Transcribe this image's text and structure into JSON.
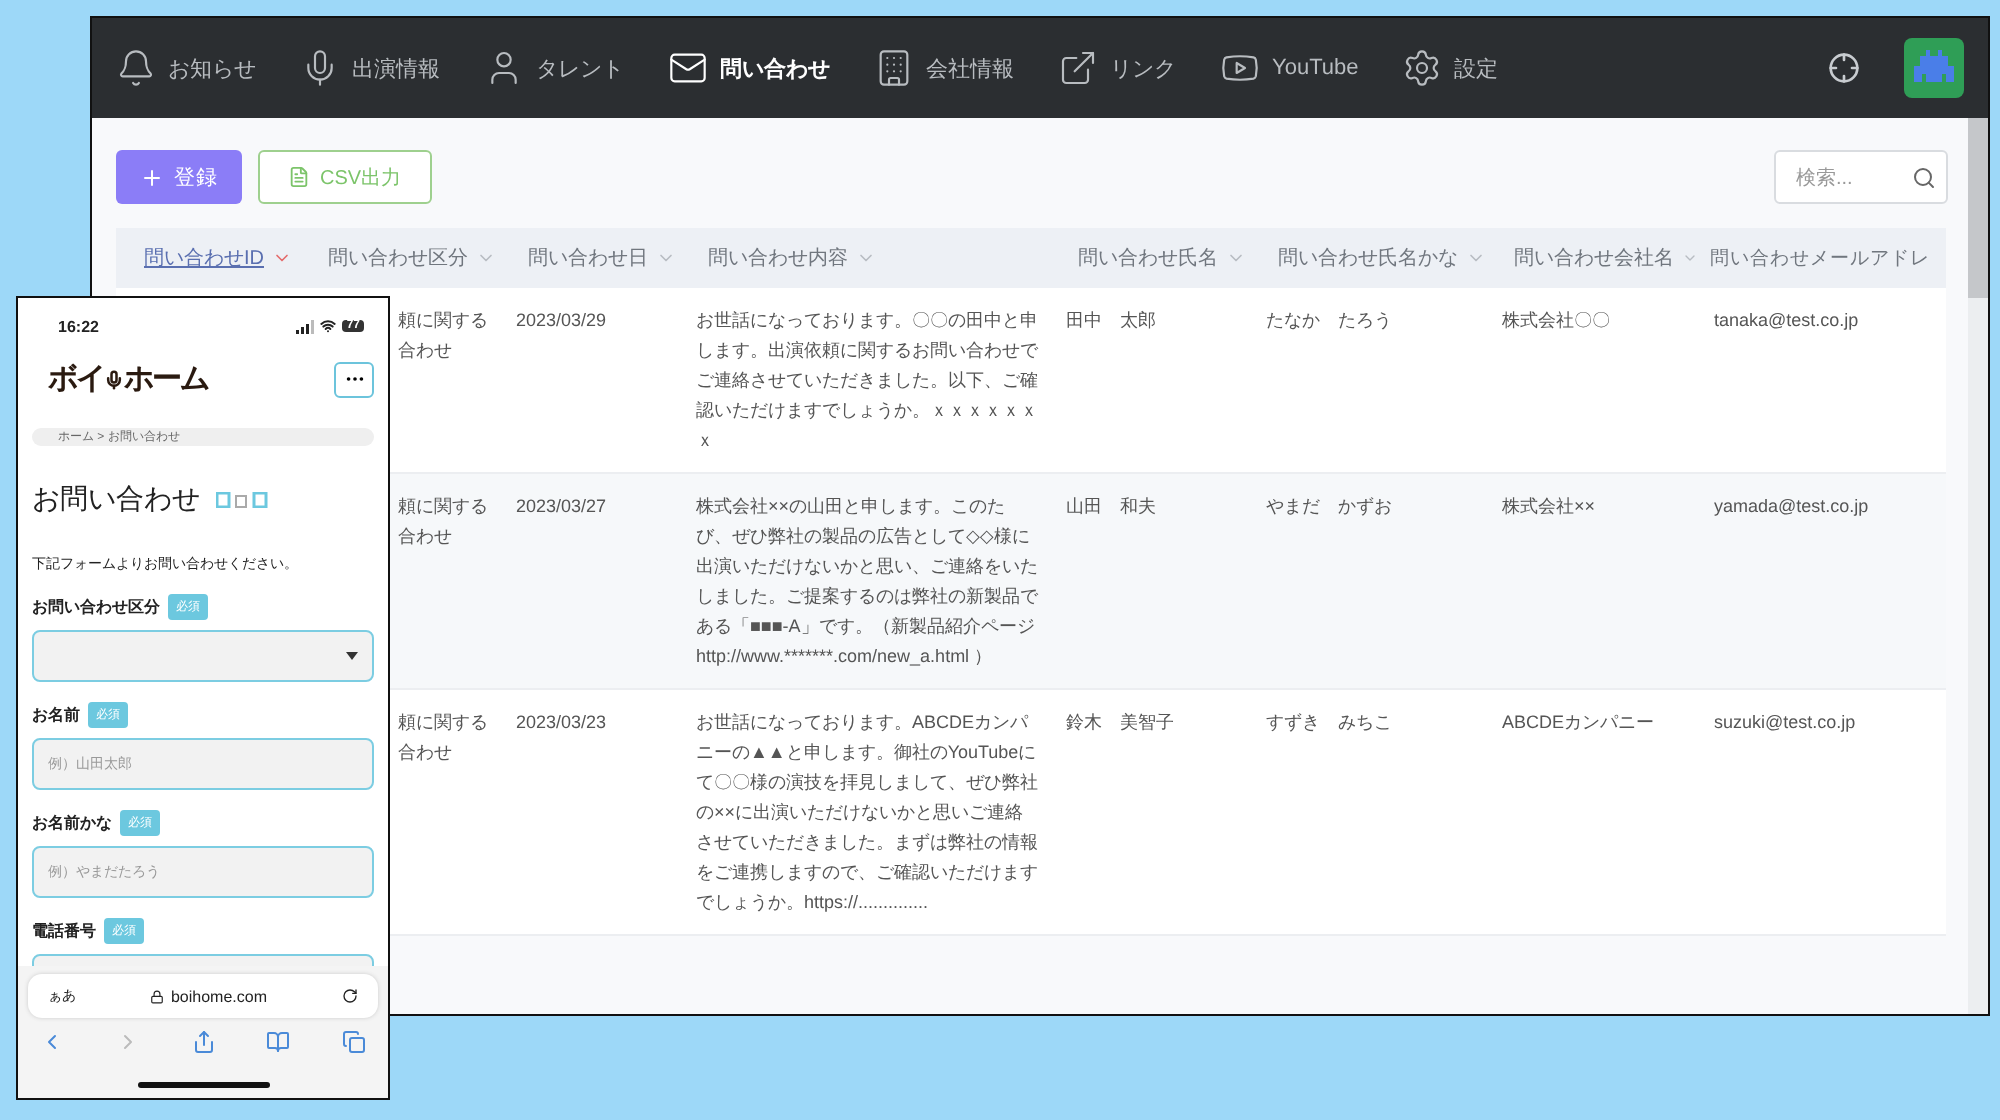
{
  "desktop": {
    "nav": [
      {
        "label": "お知らせ",
        "selected": false
      },
      {
        "label": "出演情報",
        "selected": false
      },
      {
        "label": "タレント",
        "selected": false
      },
      {
        "label": "問い合わせ",
        "selected": true
      },
      {
        "label": "会社情報",
        "selected": false
      },
      {
        "label": "リンク",
        "selected": false
      },
      {
        "label": "YouTube",
        "selected": false
      },
      {
        "label": "設定",
        "selected": false
      }
    ],
    "toolbar": {
      "add_button": "登録",
      "csv_button": "CSV出力",
      "search": {
        "placeholder": "検索..."
      }
    },
    "table": {
      "columns": [
        {
          "label": "問い合わせID",
          "sorted": true
        },
        {
          "label": "問い合わせ区分",
          "sorted": false
        },
        {
          "label": "問い合わせ日",
          "sorted": false
        },
        {
          "label": "問い合わせ内容",
          "sorted": false
        },
        {
          "label": "問い合わせ氏名",
          "sorted": false
        },
        {
          "label": "問い合わせ氏名かな",
          "sorted": false
        },
        {
          "label": "問い合わせ会社名",
          "sorted": false
        },
        {
          "label": "問い合わせメールアドレ",
          "sorted": false
        }
      ],
      "rows": [
        {
          "category": [
            "頼に関する",
            "合わせ"
          ],
          "date": "2023/03/29",
          "content": "お世話になっております。〇〇の田中と申します。出演依頼に関するお問い合わせでご連絡させていただきました。以下、ご確認いただけますでしょうか。ｘｘｘｘｘｘｘ",
          "name": "田中　太郎",
          "kana": "たなか　たろう",
          "company": "株式会社〇〇",
          "email": "tanaka@test.co.jp"
        },
        {
          "category": [
            "頼に関する",
            "合わせ"
          ],
          "date": "2023/03/27",
          "content": "株式会社××の山田と申します。このたび、ぜひ弊社の製品の広告として◇◇様に出演いただけないかと思い、ご連絡をいたしました。ご提案するのは弊社の新製品である「■■■-A」です。（新製品紹介ページ http://www.*******.com/new_a.html ）",
          "name": "山田　和夫",
          "kana": "やまだ　かずお",
          "company": "株式会社××",
          "email": "yamada@test.co.jp"
        },
        {
          "category": [
            "頼に関する",
            "合わせ"
          ],
          "date": "2023/03/23",
          "content": "お世話になっております。ABCDEカンパニーの▲▲と申します。御社のYouTubeにて〇〇様の演技を拝見しまして、ぜひ弊社の××に出演いただけないかと思いご連絡させていただきました。まずは弊社の情報をご連携しますので、ご確認いただけますでしょうか。https://..............",
          "name": "鈴木　美智子",
          "kana": "すずき　みちこ",
          "company": "ABCDEカンパニー",
          "email": "suzuki@test.co.jp"
        }
      ]
    }
  },
  "phone": {
    "status": {
      "time": "16:22",
      "battery": "77"
    },
    "logo": [
      "ボイ",
      "ホーム"
    ],
    "breadcrumb": "ホーム > お問い合わせ",
    "heading": "お問い合わせ",
    "intro": "下記フォームよりお問い合わせください。",
    "fields": [
      {
        "kind": "select",
        "label": "お問い合わせ区分",
        "badge": "必須"
      },
      {
        "kind": "text",
        "label": "お名前",
        "badge": "必須",
        "placeholder": "例）山田太郎"
      },
      {
        "kind": "text",
        "label": "お名前かな",
        "badge": "必須",
        "placeholder": "例）やまだたろう"
      },
      {
        "kind": "text",
        "label": "電話番号",
        "badge": "必須"
      }
    ],
    "browser": {
      "text_size": "ぁあ",
      "url": "boihome.com"
    }
  }
}
